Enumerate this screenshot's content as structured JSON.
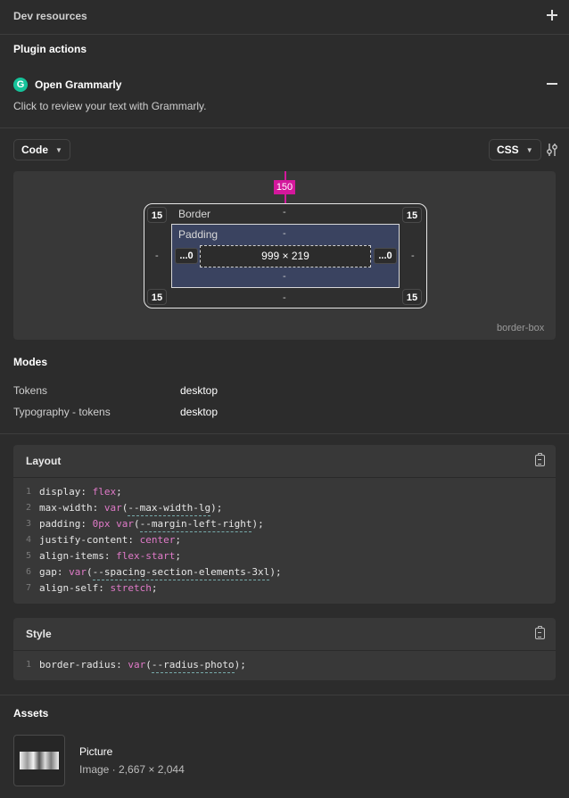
{
  "dev_resources": {
    "title": "Dev resources"
  },
  "plugin_actions": {
    "title": "Plugin actions",
    "plugin_name": "Open Grammarly",
    "plugin_logo": "G",
    "description": "Click to review your text with Grammarly."
  },
  "code_toolbar": {
    "mode_label": "Code",
    "language_label": "CSS"
  },
  "box_model": {
    "margin_top": "150",
    "border_label": "Border",
    "padding_label": "Padding",
    "corner_radius": {
      "tl": "15",
      "tr": "15",
      "bl": "15",
      "br": "15"
    },
    "border_top": "-",
    "border_bottom": "-",
    "border_left": "-",
    "border_right": "-",
    "padding_top": "-",
    "padding_bottom": "-",
    "padding_left": "...0",
    "padding_right": "...0",
    "content_size": "999 × 219",
    "box_sizing": "border-box"
  },
  "modes": {
    "title": "Modes",
    "items": [
      {
        "key": "Tokens",
        "value": "desktop"
      },
      {
        "key": "Typography - tokens",
        "value": "desktop"
      }
    ]
  },
  "layout_panel": {
    "title": "Layout",
    "lines": [
      {
        "n": "1",
        "prop": "display",
        "val": "flex"
      },
      {
        "n": "2",
        "prop": "max-width",
        "fn": "var",
        "var": "--max-width-lg"
      },
      {
        "n": "3",
        "prop": "padding",
        "num": "0px",
        "fn": "var",
        "var": "--margin-left-right"
      },
      {
        "n": "4",
        "prop": "justify-content",
        "val": "center"
      },
      {
        "n": "5",
        "prop": "align-items",
        "val": "flex-start"
      },
      {
        "n": "6",
        "prop": "gap",
        "fn": "var",
        "var": "--spacing-section-elements-3xl"
      },
      {
        "n": "7",
        "prop": "align-self",
        "val": "stretch"
      }
    ]
  },
  "style_panel": {
    "title": "Style",
    "lines": [
      {
        "n": "1",
        "prop": "border-radius",
        "fn": "var",
        "var": "--radius-photo"
      }
    ]
  },
  "assets": {
    "title": "Assets",
    "items": [
      {
        "name": "Picture",
        "meta": "Image · 2,667 × 2,044"
      }
    ]
  }
}
